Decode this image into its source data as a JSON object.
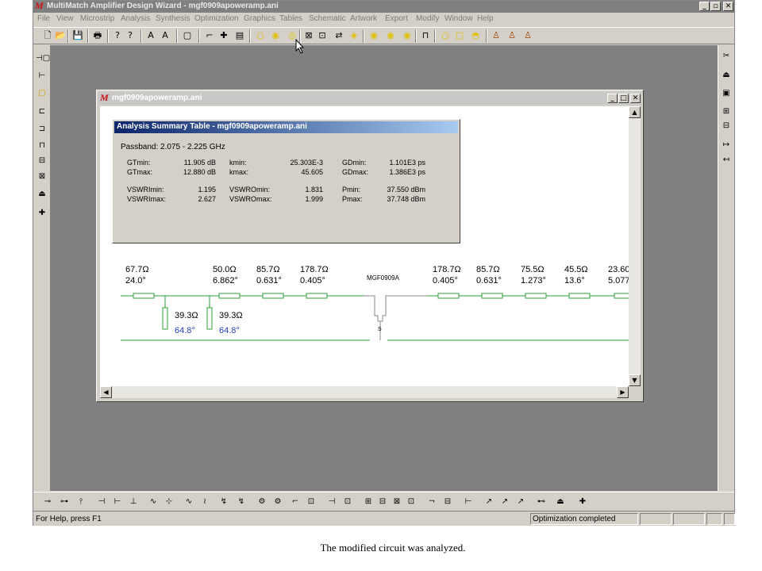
{
  "app": {
    "title": "MultiMatch Amplifier Design Wizard - mgf0909apoweramp.ani",
    "logo": "M",
    "caption_buttons": [
      "_",
      "▫",
      "✕"
    ]
  },
  "menu": [
    "File",
    "View",
    "Microstrip",
    "Analysis",
    "Synthesis",
    "Optimization",
    "Graphics",
    "Tables",
    "Schematic",
    "Artwork",
    "Export",
    "Modify",
    "Window",
    "Help"
  ],
  "toolbar": [
    "new-file-icon",
    "open-folder-icon",
    "save-icon",
    "print-icon",
    "help-icon",
    "context-help-icon",
    "a-tool-icon",
    "a-tool-2-icon",
    "resize-icon",
    "component-1-icon",
    "component-2-icon",
    "component-3-icon",
    "circle-yellow-icon",
    "circle-f-icon",
    "circle-target-icon",
    "box-x-icon",
    "box-2-icon",
    "arrows-icon",
    "cloud-icon",
    "s-yellow-icon",
    "s-arrow-icon",
    "s-dot-icon",
    "pulse-icon",
    "circle-white-icon",
    "square-icon",
    "circle-gray-icon",
    "people-1-icon",
    "people-2-icon",
    "people-3-icon"
  ],
  "child": {
    "title": "mgf0909apoweramp.ani",
    "buttons": [
      "_",
      "□",
      "✕"
    ]
  },
  "summary": {
    "title": "Analysis Summary Table - mgf0909apoweramp.ani",
    "passband": "Passband: 2.075 - 2.225 GHz",
    "rows": [
      [
        [
          "GTmin:",
          "11.905 dB"
        ],
        [
          "kmin:",
          "25.303E-3"
        ],
        [
          "GDmin:",
          "1.101E3 ps"
        ]
      ],
      [
        [
          "GTmax:",
          "12.880 dB"
        ],
        [
          "kmax:",
          "45.605"
        ],
        [
          "GDmax:",
          "1.386E3 ps"
        ]
      ],
      [
        [
          "VSWRImin:",
          "1.195"
        ],
        [
          "VSWROmin:",
          "1.831"
        ],
        [
          "Pmin:",
          "37.550 dBm"
        ]
      ],
      [
        [
          "VSWRImax:",
          "2.627"
        ],
        [
          "VSWROmax:",
          "1.999"
        ],
        [
          "Pmax:",
          "37.748 dBm"
        ]
      ]
    ]
  },
  "schematic": {
    "series_left": [
      {
        "z": "67.7Ω",
        "angle": "24.0°"
      },
      {
        "z": "50.0Ω",
        "angle": "6.862°"
      },
      {
        "z": "85.7Ω",
        "angle": "0.631°"
      },
      {
        "z": "178.7Ω",
        "angle": "0.405°"
      }
    ],
    "stubs": [
      {
        "z": "39.3Ω",
        "angle": "64.8°"
      },
      {
        "z": "39.3Ω",
        "angle": "64.8°"
      }
    ],
    "device": "MGF0909A",
    "device_pin": "S",
    "series_right": [
      {
        "z": "178.7Ω",
        "angle": "0.405°"
      },
      {
        "z": "85.7Ω",
        "angle": "0.631°"
      },
      {
        "z": "75.5Ω",
        "angle": "1.273°"
      },
      {
        "z": "45.5Ω",
        "angle": "13.6°"
      },
      {
        "z": "23.60",
        "angle": "5.077"
      }
    ],
    "line_color": "#2e9e3a"
  },
  "left_toolbar": [
    "port-icon",
    "source-icon",
    "yellow-box-icon",
    "cir-icon",
    "clr-icon",
    "inductor-icon",
    "gnd-icon",
    "k-box-icon",
    "mount-icon",
    "cross-icon"
  ],
  "right_toolbar": [
    "scissors-icon",
    "mount-right-icon",
    "box-1-icon",
    "plus-box-icon",
    "minus-box-icon",
    "arrow-in-icon",
    "arrow-out-icon"
  ],
  "status": {
    "help": "For Help, press F1",
    "message": "Optimization completed"
  },
  "caption": "The modified circuit was analyzed."
}
